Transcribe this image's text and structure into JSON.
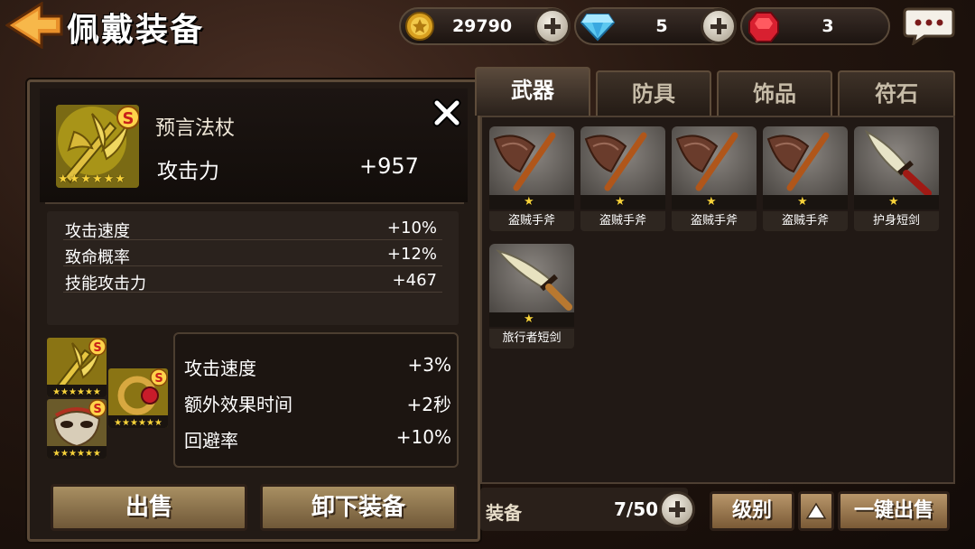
{
  "header": {
    "title": "佩戴装备",
    "back_icon": "back-arrow-icon",
    "chat_icon": "chat-bubble-icon"
  },
  "currencies": [
    {
      "name": "gold",
      "icon": "gold-coin-icon",
      "value": "29790"
    },
    {
      "name": "diamond",
      "icon": "diamond-icon",
      "value": "5"
    },
    {
      "name": "ruby",
      "icon": "ruby-icon",
      "value": "3"
    }
  ],
  "detail": {
    "name": "预言法杖",
    "grade": "S",
    "stars": 6,
    "main_stat": {
      "label": "攻击力",
      "value": "+957"
    },
    "stats": [
      {
        "label": "攻击速度",
        "value": "+10%"
      },
      {
        "label": "致命概率",
        "value": "+12%"
      },
      {
        "label": "技能攻击力",
        "value": "+467"
      }
    ],
    "set_bonus": [
      {
        "label": "攻击速度",
        "value": "+3%"
      },
      {
        "label": "额外效果时间",
        "value": "+2秒"
      },
      {
        "label": "回避率",
        "value": "+10%"
      }
    ],
    "set_items": [
      {
        "icon": "staff-icon",
        "grade": "S",
        "stars": 6
      },
      {
        "icon": "ring-icon",
        "grade": "S",
        "stars": 6
      },
      {
        "icon": "mask-icon",
        "grade": "S",
        "stars": 6
      }
    ],
    "sell_label": "出售",
    "unequip_label": "卸下装备"
  },
  "tabs": [
    {
      "label": "武器",
      "active": true
    },
    {
      "label": "防具",
      "active": false
    },
    {
      "label": "饰品",
      "active": false
    },
    {
      "label": "符石",
      "active": false
    }
  ],
  "inventory": [
    {
      "name": "盗贼手斧",
      "icon": "axe-icon",
      "stars": 1
    },
    {
      "name": "盗贼手斧",
      "icon": "axe-icon",
      "stars": 1
    },
    {
      "name": "盗贼手斧",
      "icon": "axe-icon",
      "stars": 1
    },
    {
      "name": "盗贼手斧",
      "icon": "axe-icon",
      "stars": 1
    },
    {
      "name": "护身短剑",
      "icon": "sword-icon",
      "stars": 1
    },
    {
      "name": "旅行者短剑",
      "icon": "sword-icon",
      "stars": 1
    }
  ],
  "footer": {
    "equip_label": "装备",
    "count": "7/50",
    "sort_label": "级别",
    "sort_dir_icon": "triangle-up-icon",
    "sell_all_label": "一键出售"
  },
  "colors": {
    "accent": "#f7d23a",
    "gold_button": "#a88f62",
    "panel": "#221a15"
  }
}
